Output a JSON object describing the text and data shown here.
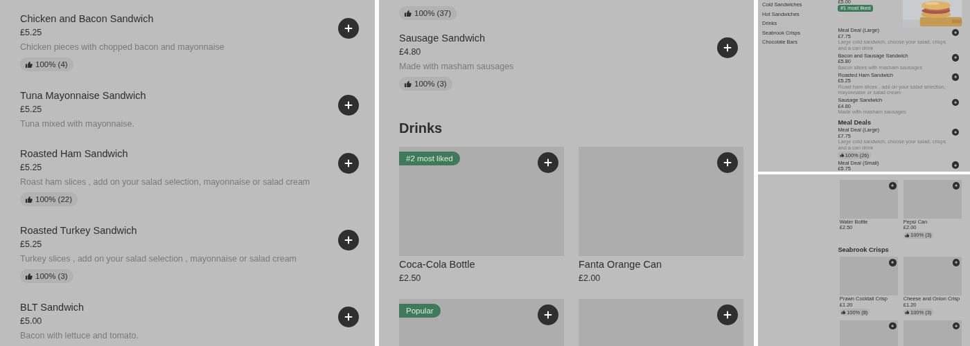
{
  "panels": [
    {
      "kind": "detail",
      "blocks": [
        {
          "kind": "item",
          "name": "Chicken and Bacon Sandwich",
          "price": "£5.25",
          "description": "Chicken pieces with chopped bacon and mayonnaise",
          "rating": "100% (4)"
        },
        {
          "kind": "item",
          "name": "Tuna Mayonnaise Sandwich",
          "price": "£5.25",
          "description": "Tuna mixed with mayonnaise."
        },
        {
          "kind": "item",
          "name": "Roasted Ham Sandwich",
          "price": "£5.25",
          "description": "Roast ham slices , add on your salad selection, mayonnaise or salad cream",
          "rating": "100% (22)"
        },
        {
          "kind": "item",
          "name": "Roasted Turkey Sandwich",
          "price": "£5.25",
          "description": "Turkey slices , add on your salad selection , mayonnaise or salad cream",
          "rating": "100% (3)"
        },
        {
          "kind": "item",
          "name": "BLT Sandwich",
          "price": "£5.00",
          "description": "Bacon with lettuce and tomato."
        }
      ]
    },
    {
      "kind": "detail",
      "blocks": [
        {
          "kind": "rating",
          "rating": "100% (37)"
        },
        {
          "kind": "item",
          "name": "Sausage Sandwich",
          "price": "£4.80",
          "description": "Made with masham sausages",
          "rating": "100% (3)"
        },
        {
          "kind": "heading",
          "text": "Drinks"
        },
        {
          "kind": "tiles",
          "tiles": [
            {
              "kind": "tile",
              "name": "Coca-Cola Bottle",
              "price": "£2.50",
              "tag": "#2 most liked"
            },
            {
              "kind": "tile",
              "name": "Fanta Orange Can",
              "price": "£2.00"
            },
            {
              "kind": "tile",
              "tag": "Popular"
            },
            {
              "kind": "tile"
            }
          ]
        }
      ]
    },
    {
      "kind": "overview",
      "sidebar": [
        "Cold Sandwiches",
        "Hot Sandwiches",
        "Drinks",
        "Seabrook Crisps",
        "Chocolate Bars"
      ],
      "blocks": [
        {
          "kind": "lead",
          "price": "£5.00",
          "tag": "#1 most liked"
        },
        {
          "kind": "item",
          "name": "Meal Deal (Large)",
          "price": "£7.75",
          "description": "Large cold sandwich, choose your salad, crisps and a can drink"
        },
        {
          "kind": "item",
          "name": "Bacon and Sausage Sandwich",
          "price": "£5.80",
          "description": "Bacon slices with masham sausages"
        },
        {
          "kind": "item",
          "name": "Roasted Ham Sandwich",
          "price": "£5.25",
          "description": "Roast ham slices , add on your salad selection, mayonnaise or salad cream"
        },
        {
          "kind": "item",
          "name": "Sausage Sandwich",
          "price": "£4.80",
          "description": "Made with masham sausages"
        },
        {
          "kind": "heading",
          "text": "Meal Deals"
        },
        {
          "kind": "item",
          "name": "Meal Deal (Large)",
          "price": "£7.75",
          "description": "Large cold sandwich, choose your salad, crisps and a can drink",
          "rating": "100% (26)"
        },
        {
          "kind": "item",
          "name": "Meal Deal (Small)",
          "price": "£5.75"
        }
      ]
    },
    {
      "kind": "overview",
      "blocks": [
        {
          "kind": "tiles",
          "tiles": [
            {
              "kind": "tile",
              "name": "Water Bottle",
              "price": "£2.50"
            },
            {
              "kind": "tile",
              "name": "Pepsi Can",
              "price": "£2.00",
              "rating": "100% (3)"
            }
          ]
        },
        {
          "kind": "heading",
          "text": "Seabrook Crisps"
        },
        {
          "kind": "tiles",
          "tiles": [
            {
              "kind": "tile",
              "name": "Prawn Cocktail Crisp",
              "price": "£1.20",
              "rating": "100% (8)"
            },
            {
              "kind": "tile",
              "name": "Cheese and Onion Crisp",
              "price": "£1.20",
              "rating": "100% (3)"
            },
            {
              "kind": "tile"
            },
            {
              "kind": "tile"
            }
          ]
        }
      ]
    }
  ]
}
